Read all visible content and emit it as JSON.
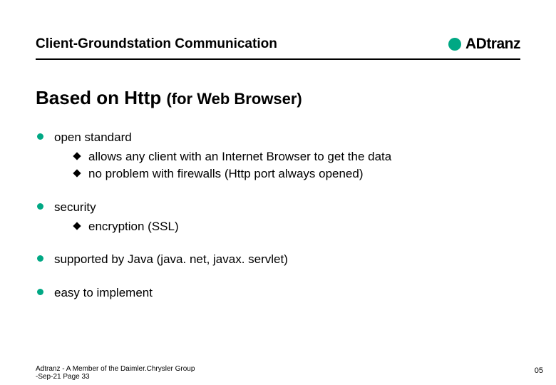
{
  "header": {
    "title": "Client-Groundstation Communication",
    "logo_text": "ADtranz"
  },
  "main_title_prefix": "Based on Http ",
  "main_title_sub": "(for Web Browser)",
  "bullets": {
    "b0": {
      "label": "open standard",
      "s0": "allows any client with an Internet Browser to get the data",
      "s1": "no problem with firewalls (Http port always opened)"
    },
    "b1": {
      "label": "security",
      "s0": "encryption (SSL)"
    },
    "b2": {
      "label": "supported by Java (java. net, javax. servlet)"
    },
    "b3": {
      "label": "easy to implement"
    }
  },
  "footer": {
    "line1": "Adtranz - A Member of the Daimler.Chrysler Group",
    "line2": "-Sep-21   Page 33"
  },
  "page_number": "05"
}
